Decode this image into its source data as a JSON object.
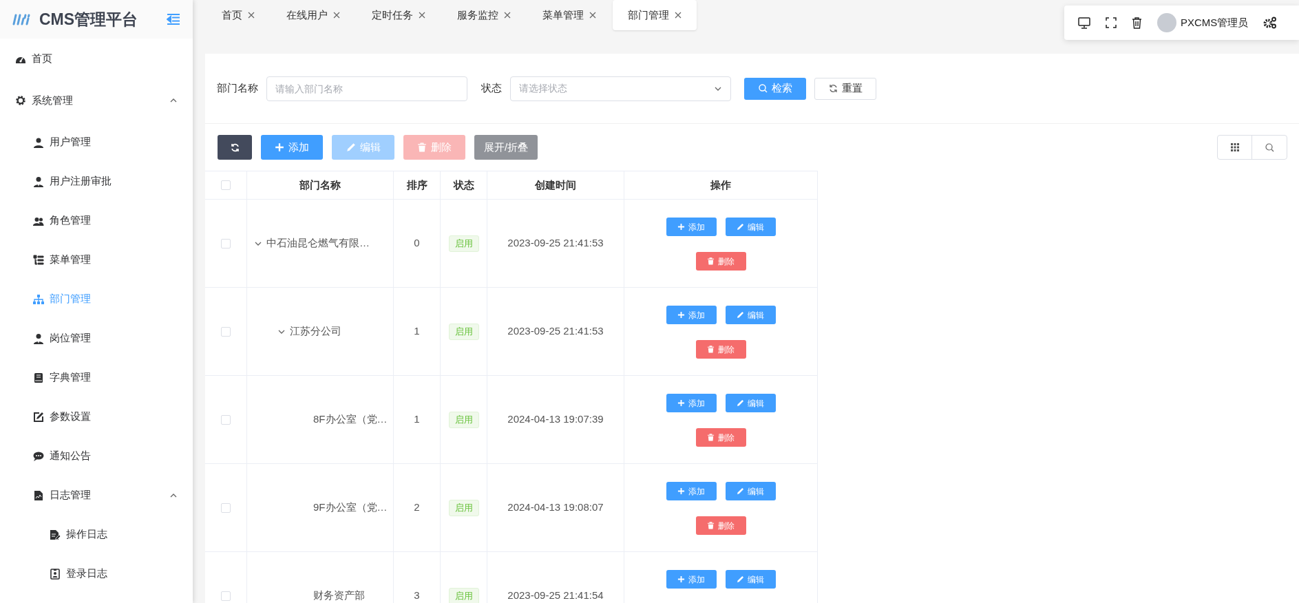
{
  "sidebar": {
    "logo_text": "CMS管理平台",
    "items": [
      {
        "label": "首页",
        "selected": false
      },
      {
        "label": "系统管理",
        "selected": false,
        "expanded": true,
        "children": [
          {
            "label": "用户管理",
            "selected": false
          },
          {
            "label": "用户注册审批",
            "selected": false
          },
          {
            "label": "角色管理",
            "selected": false
          },
          {
            "label": "菜单管理",
            "selected": false
          },
          {
            "label": "部门管理",
            "selected": true
          },
          {
            "label": "岗位管理",
            "selected": false
          },
          {
            "label": "字典管理",
            "selected": false
          },
          {
            "label": "参数设置",
            "selected": false
          },
          {
            "label": "通知公告",
            "selected": false
          },
          {
            "label": "日志管理",
            "selected": false,
            "expanded": true,
            "children": [
              {
                "label": "操作日志",
                "selected": false
              },
              {
                "label": "登录日志",
                "selected": false
              }
            ]
          }
        ]
      }
    ]
  },
  "tabs": [
    {
      "label": "首页",
      "selected": false
    },
    {
      "label": "在线用户",
      "selected": false
    },
    {
      "label": "定时任务",
      "selected": false
    },
    {
      "label": "服务监控",
      "selected": false
    },
    {
      "label": "菜单管理",
      "selected": false
    },
    {
      "label": "部门管理",
      "selected": true
    }
  ],
  "user_panel": {
    "user_name": "PXCMS管理员"
  },
  "search": {
    "fields": [
      {
        "kind": "input",
        "label": "部门名称",
        "placeholder": "请输入部门名称"
      },
      {
        "kind": "select",
        "label": "状态",
        "placeholder": "请选择状态"
      }
    ],
    "buttons": [
      {
        "kind": "search",
        "label": "检索"
      },
      {
        "kind": "reset",
        "label": "重置"
      }
    ]
  },
  "toolbar": [
    {
      "kind": "refresh",
      "disabled": false
    },
    {
      "kind": "add",
      "label": "添加",
      "disabled": false
    },
    {
      "kind": "edit",
      "label": "编辑",
      "disabled": true
    },
    {
      "kind": "delete",
      "label": "删除",
      "disabled": true
    },
    {
      "kind": "toggle",
      "label": "展开/折叠",
      "disabled": false
    }
  ],
  "table": {
    "columns": [
      "部门名称",
      "排序",
      "状态",
      "创建时间",
      "操作"
    ],
    "all_checked": false,
    "rows": [
      {
        "name": "中石油昆仑燃气有限…",
        "sort": "0",
        "status": "启用",
        "created": "2023-09-25 21:41:53",
        "checked": false,
        "expanded": true,
        "actions": [
          {
            "kind": "add",
            "label": "添加"
          },
          {
            "kind": "edit",
            "label": "编辑"
          },
          {
            "kind": "delete",
            "label": "删除"
          }
        ],
        "children": [
          {
            "name": "江苏分公司",
            "sort": "1",
            "status": "启用",
            "created": "2023-09-25 21:41:53",
            "checked": false,
            "expanded": true,
            "actions": [
              {
                "kind": "add",
                "label": "添加"
              },
              {
                "kind": "edit",
                "label": "编辑"
              },
              {
                "kind": "delete",
                "label": "删除"
              }
            ],
            "children": [
              {
                "name": "8F办公室（党…",
                "sort": "1",
                "status": "启用",
                "created": "2024-04-13 19:07:39",
                "checked": false,
                "actions": [
                  {
                    "kind": "add",
                    "label": "添加"
                  },
                  {
                    "kind": "edit",
                    "label": "编辑"
                  },
                  {
                    "kind": "delete",
                    "label": "删除"
                  }
                ]
              },
              {
                "name": "9F办公室（党…",
                "sort": "2",
                "status": "启用",
                "created": "2024-04-13 19:08:07",
                "checked": false,
                "actions": [
                  {
                    "kind": "add",
                    "label": "添加"
                  },
                  {
                    "kind": "edit",
                    "label": "编辑"
                  },
                  {
                    "kind": "delete",
                    "label": "删除"
                  }
                ]
              },
              {
                "name": "财务资产部",
                "sort": "3",
                "status": "启用",
                "created": "2023-09-25 21:41:54",
                "checked": false,
                "actions": [
                  {
                    "kind": "add",
                    "label": "添加"
                  },
                  {
                    "kind": "edit",
                    "label": "编辑"
                  }
                ]
              }
            ]
          }
        ]
      }
    ]
  }
}
